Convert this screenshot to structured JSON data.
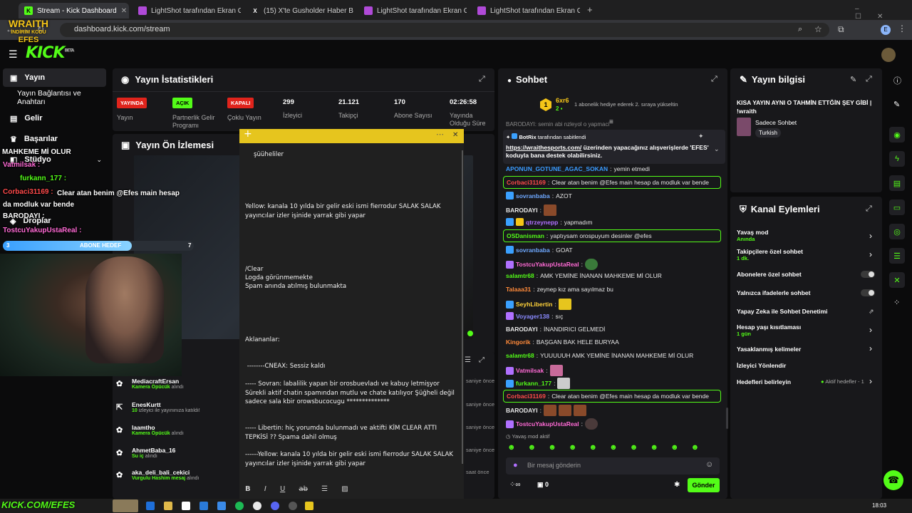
{
  "browser": {
    "tabs": [
      {
        "title": "Stream - Kick Dashboard",
        "active": true
      },
      {
        "title": "LightShot tarafından Ekran Gör"
      },
      {
        "title": "(15) X'te Gusholder Haber Bültü"
      },
      {
        "title": "LightShot tarafından Ekran Gör"
      },
      {
        "title": "LightShot tarafından Ekran Gör"
      }
    ],
    "url": "dashboard.kick.com/stream"
  },
  "header": {
    "logo": "KICK",
    "logo_sup": "BETA"
  },
  "sidebar": {
    "items": [
      {
        "label": "Yayın"
      },
      {
        "label": "Yayın Bağlantısı ve Anahtarı"
      },
      {
        "label": "Gelir"
      },
      {
        "label": "Başarılar"
      },
      {
        "label": "Stüdyo"
      },
      {
        "label": "Droplar"
      }
    ]
  },
  "overlay": {
    "brand_top": "WRAITH",
    "brand_mid": "İNDİRİM KODU",
    "brand_bot": "EFES",
    "mahkeme": "MAHKEME Mİ OLUR",
    "vatmilsak": "Vatmilsak :",
    "furkann": "furkann_177 :",
    "corbaci_name": "Corbaci31169 :",
    "corbaci_msg": "Clear atan benim @Efes main hesap da modluk var bende",
    "barodayi": "BARODAYI :",
    "tostcu": "TostcuYakupUstaReal :",
    "abone_left": "3",
    "abone_label": "ABONE HEDEF",
    "abone_right": "7",
    "bottom_url": "KICK.COM/EFES"
  },
  "stats": {
    "title": "Yayın İstatistikleri",
    "items": [
      {
        "badge": "YAYINDA",
        "label": "Yayın"
      },
      {
        "badge": "AÇIK",
        "label": "Partnerlik Gelir Programı"
      },
      {
        "badge": "KAPALI",
        "label": "Çoklu Yayın"
      },
      {
        "value": "299",
        "label": "İzleyici"
      },
      {
        "value": "21.121",
        "label": "Takipçi"
      },
      {
        "value": "170",
        "label": "Abone Sayısı"
      },
      {
        "value": "02:26:58",
        "label": "Yayında Olduğu Süre"
      }
    ]
  },
  "preview": {
    "title": "Yayın Ön İzlemesi"
  },
  "feed": [
    {
      "name": "MediacraftErsan",
      "sub": "Kamera Öpücük",
      "sub2": "alındı",
      "time": "saniye önce"
    },
    {
      "name": "EnesKurtt",
      "sub": "10",
      "sub2": "izleyici ile yayınınıza katıldı!",
      "time": "saniye önce"
    },
    {
      "name": "laamtho",
      "sub": "Kamera Öpücük",
      "sub2": "alındı",
      "time": "saniye önce"
    },
    {
      "name": "AhmetBaba_16",
      "sub": "Su iç",
      "sub2": "alındı",
      "time": "saniye önce"
    },
    {
      "name": "aka_deli_bali_cekici",
      "sub": "Vurgulu Hashim mesaj",
      "sub2": "alındı",
      "time": "saat önce"
    }
  ],
  "notes": {
    "lines": [
      "şüüheliler",
      "Yellow: kanala 10 yılda bir gelir eski ismi fierrodur SALAK SALAK yayıncılar izler işinide yarrak gibi yapar",
      "/Clear",
      "Logda görünmemekte",
      "Spam anında atılmış bulunmakta",
      "Aklananlar:",
      " --------CNEAX: Sessiz kaldı",
      "----- Sovran: labalilik yapan bir orosbuevladı ve kabuy letmişyor Sürekli aktif chatin spamından mutlu ve chate katılıyor Şüğheli değil sadece sala kbir orowsbucocugu **************",
      "----- Libertin: hiç yorumda bulunmadı ve aktifti KİM CLEAR ATTI TEPKİSİ ?? Spama dahil olmuş",
      "------Yellow: kanala 10 yılda bir gelir eski ismi fierrodur SALAK SALAK yayıncılar izler işinide yarrak gibi yapar"
    ]
  },
  "chat": {
    "title": "Sohbet",
    "top_name": "6xr6",
    "top_count": "2",
    "top_rank": "1",
    "top_text": "1 abonelik hediye ederek 2. sıraya yükseltin",
    "cut_line": "BARODAYI: semin abi nzleyol o yapmaci",
    "pinned_by": "BotRix",
    "pinned_label": "tarafından sabitlendi",
    "pinned_link": "https://wraithesports.com/",
    "pinned_text": " üzerinden yapacağınız alışverişlerde 'EFES' koduyla bana destek olabilirsiniz.",
    "messages": [
      {
        "name": "APONUN_GOTUNE_AGAC_SOKAN",
        "text": "yemin etmedi",
        "color": "#3a9bff"
      },
      {
        "name": "Corbaci31169",
        "text": "Clear atan benim @Efes main hesap da modluk var bende",
        "color": "#ff4a4a",
        "boxed": true
      },
      {
        "name": "sovranbaba",
        "text": "AZOT",
        "color": "#6ea8ff"
      },
      {
        "name": "BARODAYI",
        "text": "",
        "color": "#e6e6e6"
      },
      {
        "name": "qtrzeynepp",
        "text": "yapmadım",
        "color": "#b070ff"
      },
      {
        "name": "OSDanisman",
        "text": "yaptıysam orospuyum desinler @efes",
        "color": "#53fc18",
        "boxed": true
      },
      {
        "name": "sovranbaba",
        "text": "GOAT",
        "color": "#6ea8ff"
      },
      {
        "name": "TostcuYakupUstaReal",
        "text": "",
        "color": "#ff6ad5"
      },
      {
        "name": "salamtr68",
        "text": "AMK YEMİNE İNANAN MAHKEME Mİ OLUR",
        "color": "#53fc18"
      },
      {
        "name": "Talaaa31",
        "text": "zeynep kız ama sayılmaz bu",
        "color": "#ff8a3a"
      },
      {
        "name": "SeyhLibertin",
        "text": "",
        "color": "#ffd23a"
      },
      {
        "name": "Voyager138",
        "text": "sıç",
        "color": "#8a8aff"
      },
      {
        "name": "BARODAYI",
        "text": "İNANDIRICI GELMEDİ",
        "color": "#e6e6e6"
      },
      {
        "name": "Kingorik",
        "text": "BAŞGAN BAK HELE BURYAA",
        "color": "#ff8a3a"
      },
      {
        "name": "salamtr68",
        "text": "YUUUUUH AMK YEMİNE İNANAN MAHKEME Mİ OLUR",
        "color": "#53fc18"
      },
      {
        "name": "Vatmilsak",
        "text": "",
        "color": "#ff6ad5"
      },
      {
        "name": "furkann_177",
        "text": "",
        "color": "#53fc18"
      },
      {
        "name": "Corbaci31169",
        "text": "Clear atan benim @Efes main hesap da modluk var bende",
        "color": "#ff4a4a",
        "boxed": true
      },
      {
        "name": "BARODAYI",
        "text": "",
        "color": "#e6e6e6"
      },
      {
        "name": "TostcuYakupUstaReal",
        "text": "",
        "color": "#ff6ad5"
      }
    ],
    "slow_mode": "Yavaş mod aktif",
    "input_placeholder": "Bir mesaj gönderin",
    "points": "0",
    "send_label": "Gönder"
  },
  "stream_info": {
    "title": "Yayın bilgisi",
    "stream_title": "KISA YAYIN AYNI O TAHMİN ETTĞİN ŞEY GİBİ | !wraith",
    "category": "Sadece Sohbet",
    "tag": "Turkish"
  },
  "actions": {
    "title": "Kanal Eylemleri",
    "items": [
      {
        "label": "Yavaş mod",
        "sub": "Anında"
      },
      {
        "label": "Takipçilere özel sohbet",
        "sub": "1 dk."
      },
      {
        "label": "Abonelere özel sohbet"
      },
      {
        "label": "Yalnızca ifadelerle sohbet"
      },
      {
        "label": "Yapay Zeka ile Sohbet Denetimi"
      },
      {
        "label": "Hesap yaşı kısıtlaması",
        "sub": "1 gün"
      },
      {
        "label": "Yasaklanmış kelimeler"
      },
      {
        "label": "İzleyici Yönlendir"
      },
      {
        "label": "Hedefleri belirleyin",
        "aside": "Aktif hedefler - 1"
      }
    ]
  },
  "taskbar": {
    "time": "18:03"
  },
  "colors": {
    "accent": "#53fc18",
    "panel": "#18181b",
    "notes_header": "#e6c51e"
  }
}
